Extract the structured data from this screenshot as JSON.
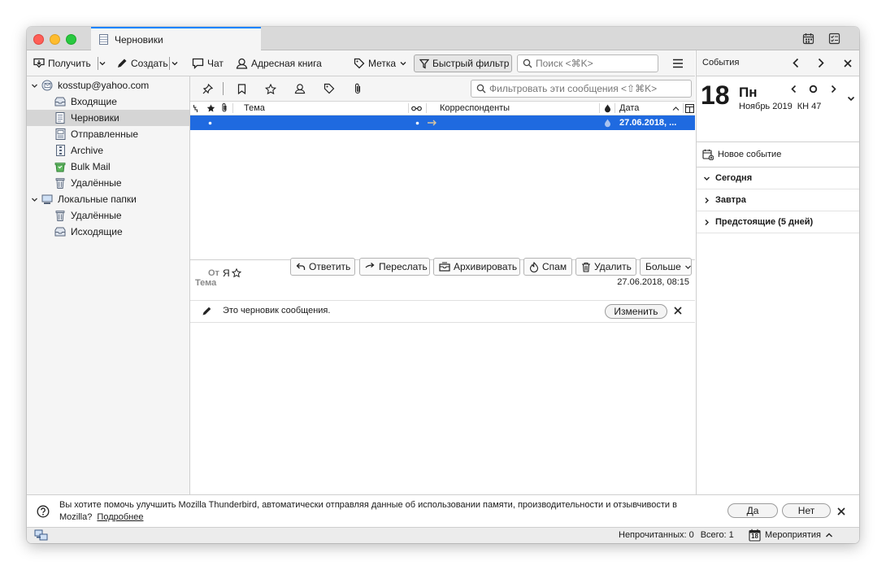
{
  "tab": {
    "title": "Черновики"
  },
  "toolbar": {
    "get_label": "Получить",
    "write_label": "Создать",
    "chat_label": "Чат",
    "addressbook_label": "Адресная книга",
    "tag_label": "Метка",
    "quickfilter_label": "Быстрый фильтр",
    "search_placeholder": "Поиск <⌘K>"
  },
  "folders": {
    "account1": "kosstup@yahoo.com",
    "items1": [
      "Входящие",
      "Черновики",
      "Отправленные",
      "Archive",
      "Bulk Mail",
      "Удалённые"
    ],
    "account2": "Локальные папки",
    "items2": [
      "Удалённые",
      "Исходящие"
    ],
    "selected": "Черновики"
  },
  "quickfilter": {
    "filter_placeholder": "Фильтровать эти сообщения <⇧⌘K>"
  },
  "columns": {
    "subject": "Тема",
    "correspondents": "Корреспонденты",
    "date": "Дата"
  },
  "messages": [
    {
      "subject": "",
      "correspondent": "",
      "date": "27.06.2018, ..."
    }
  ],
  "header": {
    "from_label": "От",
    "from_value": "Я",
    "subject_label": "Тема",
    "date": "27.06.2018, 08:15",
    "reply_label": "Ответить",
    "forward_label": "Переслать",
    "archive_label": "Архивировать",
    "spam_label": "Спам",
    "delete_label": "Удалить",
    "more_label": "Больше"
  },
  "draft_notice": {
    "text": "Это черновик сообщения.",
    "edit_label": "Изменить"
  },
  "today_pane": {
    "title": "События",
    "day_number": "18",
    "weekday": "Пн",
    "month_year": "Ноябрь 2019",
    "week": "КН 47",
    "new_event": "Новое событие",
    "today": "Сегодня",
    "tomorrow": "Завтра",
    "upcoming": "Предстоящие (5 дней)"
  },
  "notification": {
    "text_line1": "Вы хотите помочь улучшить Mozilla Thunderbird, автоматически отправляя данные об использовании памяти, производительности и отзывчивости в",
    "text_line2": "Mozilla?",
    "learn_more": "Подробнее",
    "yes_label": "Да",
    "no_label": "Нет"
  },
  "status": {
    "unread": "Непрочитанных: 0",
    "total": "Всего: 1",
    "events_label": "Мероприятия",
    "calendar_day": "18"
  },
  "colors": {
    "accent": "#0a84ff",
    "selection": "#1f6ae0"
  }
}
